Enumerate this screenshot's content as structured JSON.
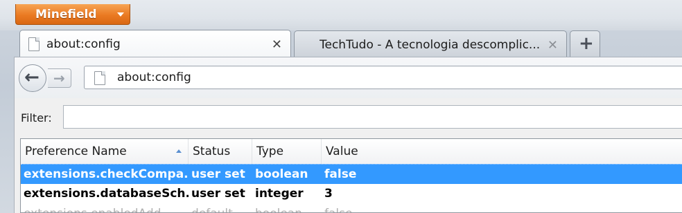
{
  "app": {
    "menu_button": "Minefield"
  },
  "tabs": [
    {
      "title": "about:config",
      "close": "✕"
    },
    {
      "title": "TechTudo - A tecnologia descomplic...",
      "close": "✕"
    }
  ],
  "new_tab": "+",
  "nav": {
    "back": "←",
    "forward": "→",
    "url": "about:config"
  },
  "filter": {
    "label": "Filter:",
    "value": ""
  },
  "table": {
    "headers": [
      "Preference Name",
      "Status",
      "Type",
      "Value"
    ],
    "rows": [
      {
        "name": "extensions.checkCompa...",
        "status": "user set",
        "type": "boolean",
        "value": "false",
        "selected": true
      },
      {
        "name": "extensions.databaseSch...",
        "status": "user set",
        "type": "integer",
        "value": "3"
      },
      {
        "name": "extensions.enabledAdd...",
        "status": "default",
        "type": "boolean",
        "value": "false"
      }
    ]
  },
  "colors": {
    "accent": "#3399ff",
    "app_button": "#ea7a22"
  }
}
